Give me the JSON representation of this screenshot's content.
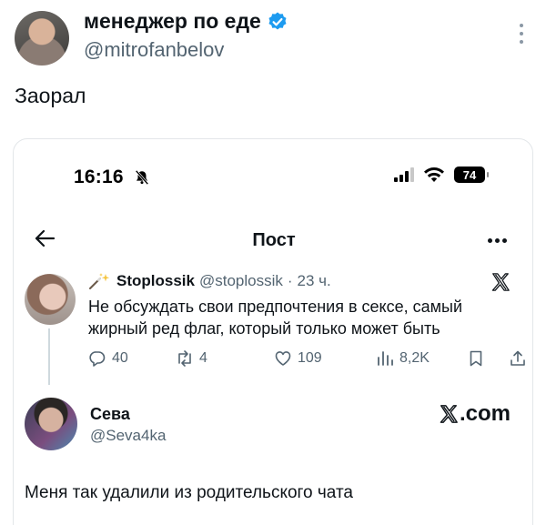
{
  "outer_post": {
    "author_name": "менеджер по еде",
    "author_handle": "@mitrofanbelov",
    "text": "Заорал"
  },
  "screenshot": {
    "status_bar": {
      "time": "16:16",
      "battery": "74"
    },
    "nav": {
      "title": "Пост"
    },
    "quoted_post": {
      "author_name": "Stoplossik",
      "author_handle": "@stoplossik",
      "separator": "·",
      "time_ago": "23 ч.",
      "text": "Не обсуждать свои предпочтения в сексе, самый жирный ред флаг, который только может быть",
      "stats": {
        "replies": "40",
        "reposts": "4",
        "likes": "109",
        "views": "8,2K"
      }
    },
    "reply_post": {
      "author_name": "Сева",
      "author_handle": "@Seva4ka",
      "watermark": ".com",
      "text": "Меня так удалили из родительского чата"
    }
  },
  "colors": {
    "text_primary": "#0f1419",
    "text_secondary": "#536471",
    "verified_blue": "#1d9bf0",
    "border": "#e3e6e9"
  }
}
